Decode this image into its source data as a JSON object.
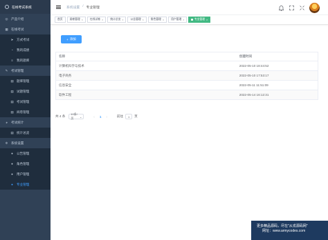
{
  "sidebar": {
    "brand": "在线考试系统",
    "menu": [
      {
        "label": "产品介绍",
        "type": "group",
        "icon": "home-icon"
      },
      {
        "label": "在线考试",
        "type": "group",
        "icon": "grid-icon"
      },
      {
        "label": "方式考试",
        "type": "sub",
        "icon": "paper-plane-icon"
      },
      {
        "label": "我的成绩",
        "type": "sub",
        "icon": "bulb-icon"
      },
      {
        "label": "我的题库",
        "type": "sub",
        "icon": "list-icon"
      },
      {
        "label": "考试管理",
        "type": "group",
        "icon": "edit-icon"
      },
      {
        "label": "题库管理",
        "type": "sub",
        "icon": "doc-icon"
      },
      {
        "label": "试题管理",
        "type": "sub",
        "icon": "doc-icon"
      },
      {
        "label": "考试管理",
        "type": "sub",
        "icon": "doc-icon"
      },
      {
        "label": "阅卷管理",
        "type": "sub",
        "icon": "doc-icon"
      },
      {
        "label": "考试统计",
        "type": "group",
        "icon": "chart-icon"
      },
      {
        "label": "统计总览",
        "type": "sub",
        "icon": "doc-icon"
      },
      {
        "label": "系统设置",
        "type": "group",
        "icon": "settings-icon"
      },
      {
        "label": "公告管理",
        "type": "sub",
        "icon": "user-icon"
      },
      {
        "label": "角色管理",
        "type": "sub",
        "icon": "user-icon"
      },
      {
        "label": "用户管理",
        "type": "sub",
        "icon": "user-icon"
      },
      {
        "label": "专业管理",
        "type": "sub",
        "icon": "user-icon",
        "active": true
      }
    ]
  },
  "header": {
    "breadcrumb": [
      "系统设置",
      "/",
      "专业管理"
    ],
    "icons": [
      "bell-icon",
      "expand-icon",
      "fullscreen-icon",
      "avatar"
    ]
  },
  "tags": [
    {
      "label": "首页",
      "closable": false
    },
    {
      "label": "阅卷管理",
      "closable": true
    },
    {
      "label": "在线试卷",
      "closable": true
    },
    {
      "label": "统计总览",
      "closable": true
    },
    {
      "label": "公告管理",
      "closable": true
    },
    {
      "label": "角色管理",
      "closable": true
    },
    {
      "label": "用户管理",
      "closable": true
    },
    {
      "label": "专业管理",
      "closable": true,
      "active": true
    }
  ],
  "add_button": {
    "icon": "+",
    "label": "添加"
  },
  "table": {
    "columns": [
      "名称",
      "创建时间"
    ],
    "rows": [
      [
        "计算机科学与技术",
        "2022-05-10 18:44:52"
      ],
      [
        "电子商务",
        "2022-05-10 17:53:17"
      ],
      [
        "信息安全",
        "2022-05-11 11:51:09"
      ],
      [
        "软件工程",
        "2022-05-14 16:12:31"
      ]
    ]
  },
  "pagination": {
    "total": "共 4 条",
    "page_size": "10条/页",
    "prev": "‹",
    "current": "1",
    "next": "›",
    "goto_label": "前往",
    "goto_value": "1",
    "goto_suffix": "页"
  },
  "watermark": {
    "line1": "更多精品源码，尽在\"从戎源码网\"",
    "line2": "网址：www.armycodes.com"
  },
  "colors": {
    "sidebar_bg": "#304156",
    "primary": "#409eff",
    "tag_active": "#42b983"
  }
}
